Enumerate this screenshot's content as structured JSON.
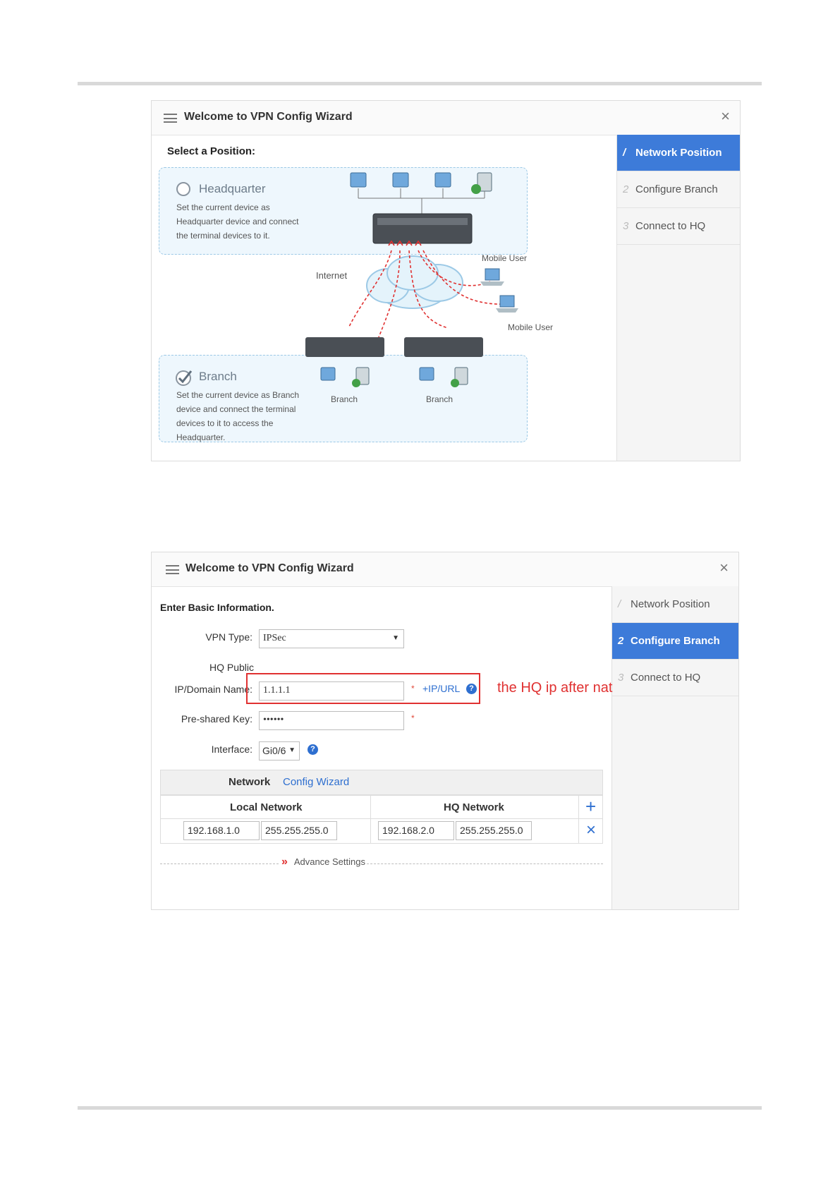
{
  "wizard1": {
    "title": "Welcome to VPN Config Wizard",
    "close": "×",
    "steps": [
      {
        "num": "/",
        "label": "Network Position",
        "active": true
      },
      {
        "num": "2",
        "label": "Configure Branch",
        "active": false
      },
      {
        "num": "3",
        "label": "Connect to HQ",
        "active": false
      }
    ],
    "select_label": "Select a Position:",
    "hq": {
      "title": "Headquarter",
      "desc": "Set the current device as Headquarter device and connect the terminal devices to it."
    },
    "branch": {
      "title": "Branch",
      "desc": "Set the current device as Branch device and connect the terminal devices to it to access the Headquarter.",
      "selected": true
    },
    "diagram": {
      "internet": "Internet",
      "mobile_user_1": "Mobile User",
      "mobile_user_2": "Mobile User",
      "branch_1": "Branch",
      "branch_2": "Branch"
    }
  },
  "wizard2": {
    "title": "Welcome to VPN Config Wizard",
    "close": "×",
    "steps": [
      {
        "num": "/",
        "label": "Network Position",
        "active": false
      },
      {
        "num": "2",
        "label": "Configure Branch",
        "active": true
      },
      {
        "num": "3",
        "label": "Connect to HQ",
        "active": false
      }
    ],
    "section_label": "Enter Basic Information.",
    "vpn_type": {
      "label": "VPN Type:",
      "value": "IPSec"
    },
    "hq_public": {
      "label_line1": "HQ Public",
      "label_line2": "IP/Domain Name:",
      "value": "1.1.1.1",
      "required": "*",
      "link": "+IP/URL",
      "help": "?"
    },
    "psk": {
      "label": "Pre-shared Key:",
      "value": "••••••",
      "required": "*"
    },
    "interface": {
      "label": "Interface:",
      "value": "Gi0/6",
      "help": "?"
    },
    "network": {
      "bar_bold": "Network",
      "bar_link": "Config Wizard",
      "local_header": "Local Network",
      "hq_header": "HQ Network",
      "add": "+",
      "remove": "×",
      "row": {
        "local_ip": "192.168.1.0",
        "local_mask": "255.255.255.0",
        "hq_ip": "192.168.2.0",
        "hq_mask": "255.255.255.0"
      }
    },
    "advance": {
      "arrow": "»",
      "label": "Advance Settings"
    },
    "annotation": "the HQ ip after nat"
  },
  "colors": {
    "accent": "#3d7bd9",
    "annotation": "#e03131",
    "link": "#2e6fd0"
  }
}
